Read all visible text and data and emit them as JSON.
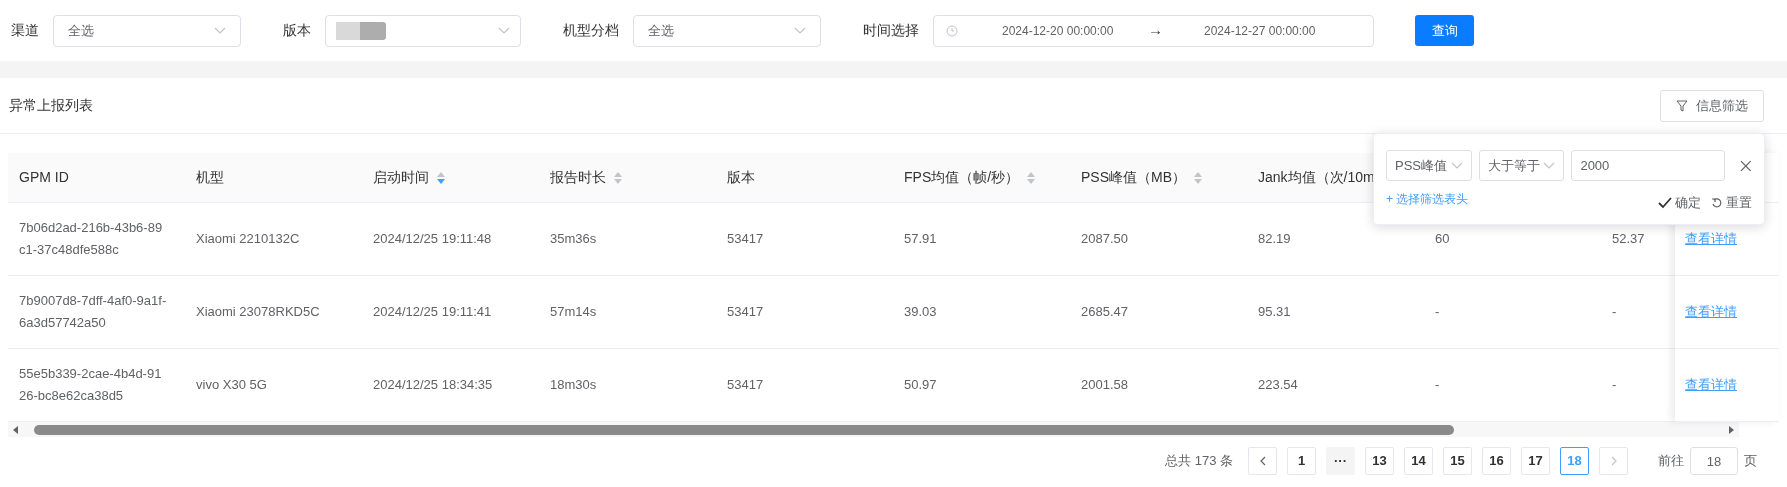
{
  "filters": [
    {
      "kind": "select",
      "label": "渠道",
      "value": "全选"
    },
    {
      "kind": "redacted",
      "label": "版本"
    },
    {
      "kind": "select",
      "label": "机型分档",
      "value": "全选"
    }
  ],
  "time_range": {
    "label": "时间选择",
    "start": "2024-12-20 00:00:00",
    "separator": "→",
    "end": "2024-12-27 00:00:00"
  },
  "query_button": "查询",
  "list": {
    "title": "异常上报列表",
    "filter_button": "信息筛选"
  },
  "table": {
    "columns": [
      {
        "label": "GPM ID"
      },
      {
        "label": "机型"
      },
      {
        "label": "启动时间",
        "sorted": true
      },
      {
        "label": "报告时长",
        "sorted": false
      },
      {
        "label": "版本"
      },
      {
        "label": "FPS均值（帧/秒）",
        "sorted": false
      },
      {
        "label": "PSS峰值（MB）",
        "sorted": false
      },
      {
        "label": "Jank均值（次/10m"
      }
    ],
    "rows": [
      {
        "cells": [
          "7b06d2ad-216b-43b6-89c1-37c48dfe588c",
          "Xiaomi 2210132C",
          "2024/12/25 19:11:48",
          "35m36s",
          "53417",
          "57.91",
          "2087.50",
          "82.19",
          "60",
          "52.37"
        ],
        "action": "查看详情"
      },
      {
        "cells": [
          "7b9007d8-7dff-4af0-9a1f-6a3d57742a50",
          "Xiaomi 23078RKD5C",
          "2024/12/25 19:11:41",
          "57m14s",
          "53417",
          "39.03",
          "2685.47",
          "95.31",
          "-",
          "-"
        ],
        "action": "查看详情"
      },
      {
        "cells": [
          "55e5b339-2cae-4b4d-9126-bc8e62ca38d5",
          "vivo X30 5G",
          "2024/12/25 18:34:35",
          "18m30s",
          "53417",
          "50.97",
          "2001.58",
          "223.54",
          "-",
          "-"
        ],
        "action": "查看详情"
      }
    ]
  },
  "filter_popover": {
    "field": "PSS峰值",
    "operator": "大于等于",
    "value": "2000",
    "add_link": "+ 选择筛选表头",
    "confirm": "确定",
    "reset": "重置"
  },
  "pagination": {
    "total": "总共 173 条",
    "prev_disabled": false,
    "next_disabled": true,
    "pages": [
      {
        "kind": "page",
        "label": "1",
        "selected": false
      },
      {
        "kind": "more",
        "label": "···"
      },
      {
        "kind": "page",
        "label": "13",
        "selected": false
      },
      {
        "kind": "page",
        "label": "14",
        "selected": false
      },
      {
        "kind": "page",
        "label": "15",
        "selected": false
      },
      {
        "kind": "page",
        "label": "16",
        "selected": false
      },
      {
        "kind": "page",
        "label": "17",
        "selected": false
      },
      {
        "kind": "page",
        "label": "18",
        "selected": true
      }
    ],
    "goto_label": "前往",
    "goto_value": "18",
    "page_unit": "页"
  }
}
